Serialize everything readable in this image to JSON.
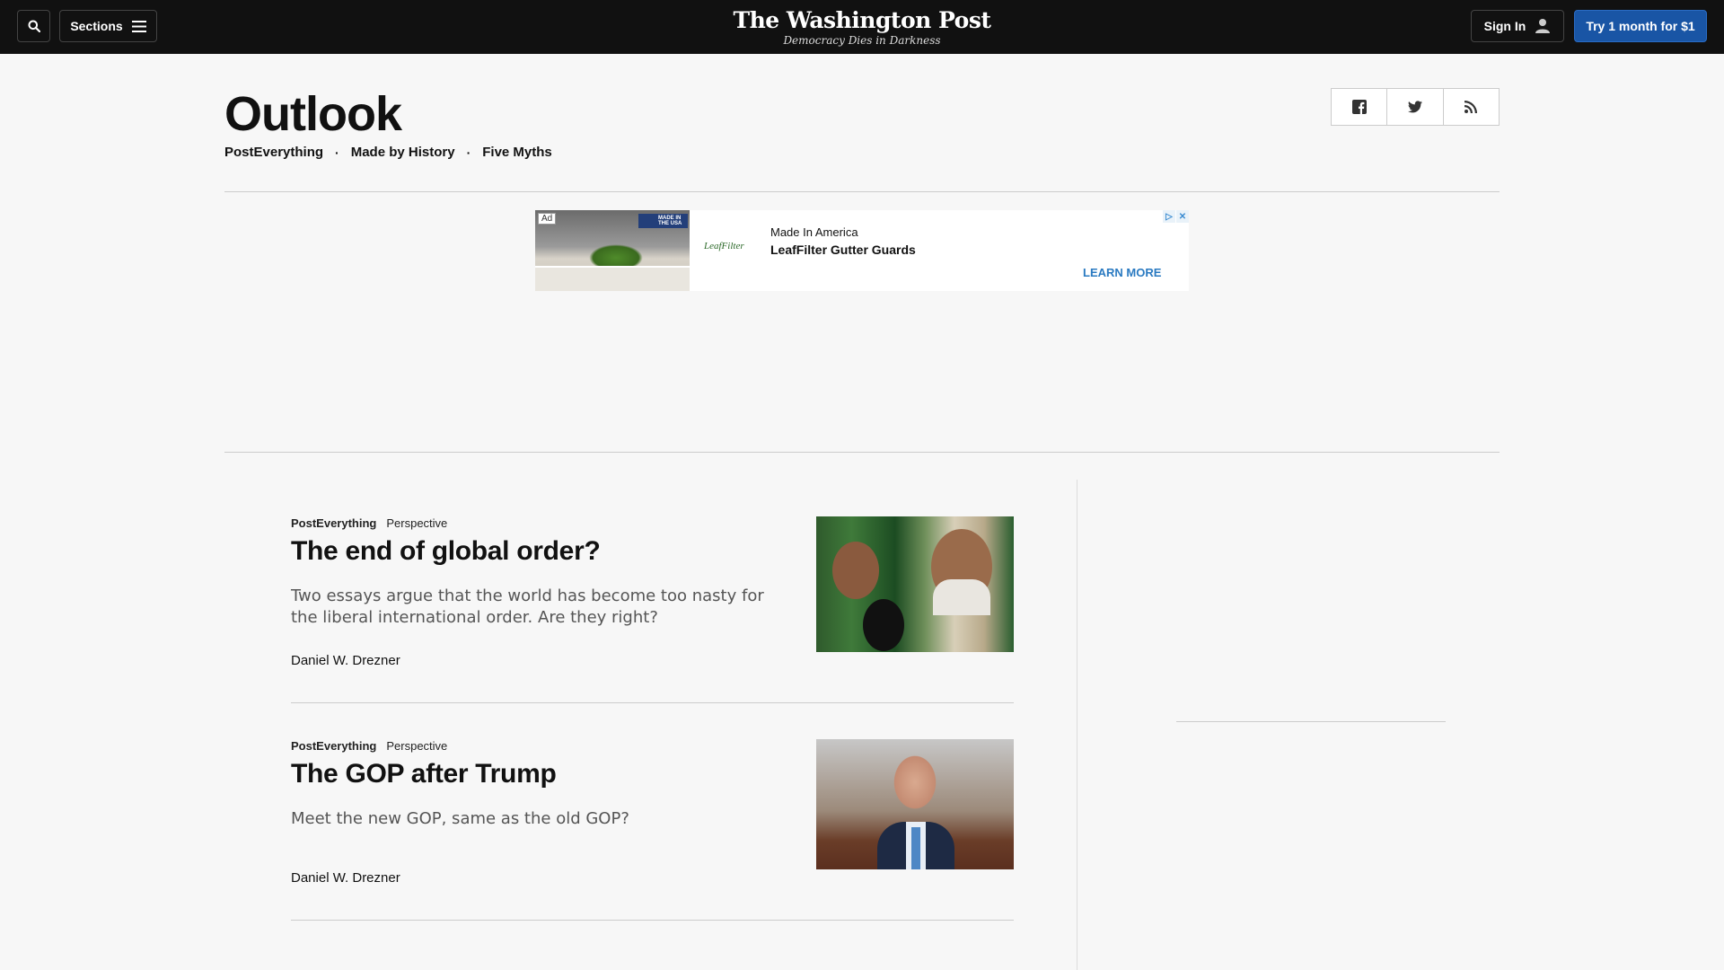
{
  "header": {
    "sections_label": "Sections",
    "logo_title": "The Washington Post",
    "logo_tagline": "Democracy Dies in Darkness",
    "signin_label": "Sign In",
    "trial_label": "Try 1 month for $1"
  },
  "section": {
    "title": "Outlook",
    "subnav": [
      "PostEverything",
      "Made by History",
      "Five Myths"
    ],
    "share_icons": [
      "facebook-icon",
      "twitter-icon",
      "rss-icon"
    ]
  },
  "ad": {
    "badge": "Ad",
    "flag_text": "MADE IN THE USA",
    "logo_text": "LeafFilter",
    "line1": "Made In America",
    "line2": "LeafFilter Gutter Guards",
    "cta": "LEARN MORE"
  },
  "stories": [
    {
      "section": "PostEverything",
      "label": "Perspective",
      "headline": "The end of global order?",
      "blurb": "Two essays argue that the world has become too nasty for the liberal international order. Are they right?",
      "byline": "Daniel W. Drezner"
    },
    {
      "section": "PostEverything",
      "label": "Perspective",
      "headline": "The GOP after Trump",
      "blurb": "Meet the new GOP, same as the old GOP?",
      "byline": "Daniel W. Drezner"
    }
  ],
  "colors": {
    "topbar": "#111111",
    "trial_button": "#1955a5",
    "ad_cta": "#2a7ac1",
    "page_bg": "#f7f7f7"
  }
}
